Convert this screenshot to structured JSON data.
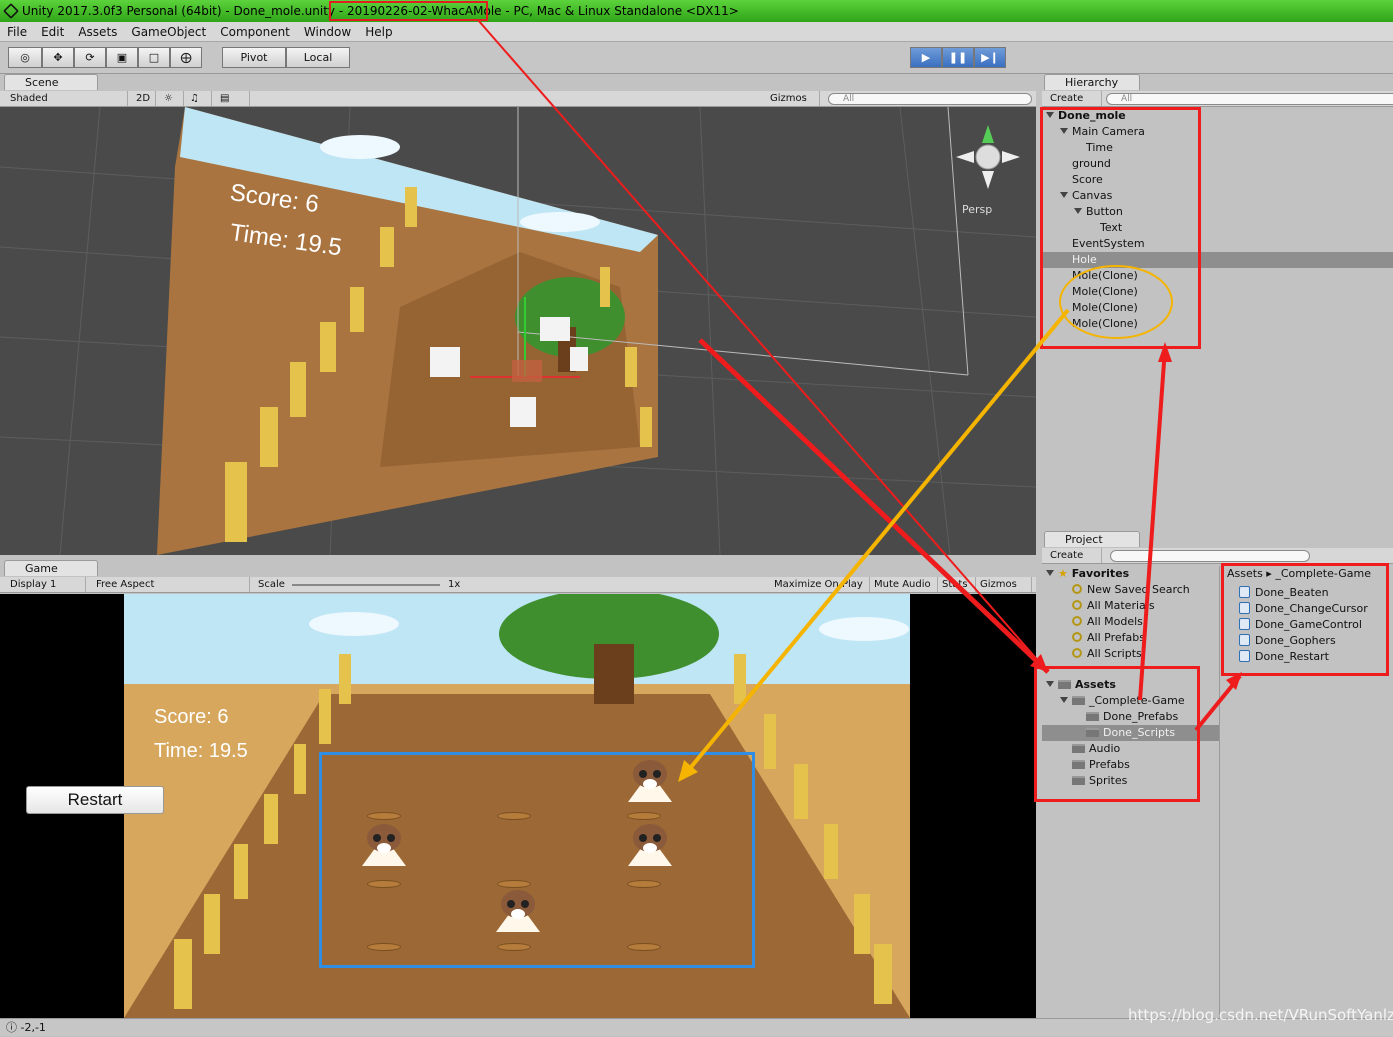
{
  "window": {
    "title_pre": "Unity 2017.3.0f3 Personal (64bit) - Done_mole.unity - ",
    "title_project": "20190226-02-WhacAMole",
    "title_post": " - PC, Mac & Linux Standalone <DX11>"
  },
  "menu": [
    "File",
    "Edit",
    "Assets",
    "GameObject",
    "Component",
    "Window",
    "Help"
  ],
  "toolbar": {
    "pivot": "Pivot",
    "local": "Local"
  },
  "scene": {
    "tab": "Scene",
    "shading": "Shaded",
    "mode2d": "2D",
    "gizmos": "Gizmos",
    "search_placeholder": "All",
    "persp": "Persp",
    "score": "Score: 6",
    "time": "Time: 19.5"
  },
  "game": {
    "tab": "Game",
    "display": "Display 1",
    "aspect": "Free Aspect",
    "scale_label": "Scale",
    "scale_value": "1x",
    "maximize": "Maximize On Play",
    "mute": "Mute Audio",
    "stats": "Stats",
    "gizmos": "Gizmos",
    "score": "Score: 6",
    "time": "Time: 19.5",
    "restart": "Restart"
  },
  "hierarchy": {
    "tab": "Hierarchy",
    "create": "Create",
    "search_placeholder": "All",
    "root": "Done_mole",
    "items": [
      "Main Camera",
      "Time",
      "ground",
      "Score",
      "Canvas",
      "Button",
      "Text",
      "EventSystem",
      "Hole",
      "Mole(Clone)",
      "Mole(Clone)",
      "Mole(Clone)",
      "Mole(Clone)"
    ]
  },
  "project": {
    "tab": "Project",
    "create": "Create",
    "favorites": "Favorites",
    "favorite_items": [
      "New Saved Search",
      "All Materials",
      "All Models",
      "All Prefabs",
      "All Scripts"
    ],
    "assets": "Assets",
    "asset_items": [
      "_Complete-Game",
      "Done_Prefabs",
      "Done_Scripts",
      "Audio",
      "Prefabs",
      "Sprites"
    ],
    "breadcrumb": [
      "Assets",
      "_Complete-Game"
    ],
    "files": [
      "Done_Beaten",
      "Done_ChangeCursor",
      "Done_GameControl",
      "Done_Gophers",
      "Done_Restart"
    ]
  },
  "status": {
    "coords": "-2,-1"
  },
  "watermark": "https://blog.csdn.net/VRunSoftYanlz",
  "colors": {
    "title_green": "#3cb822",
    "annotation_red": "#ee1c1c",
    "annotation_orange": "#f5b400",
    "highlight_blue": "#2f8de4"
  }
}
